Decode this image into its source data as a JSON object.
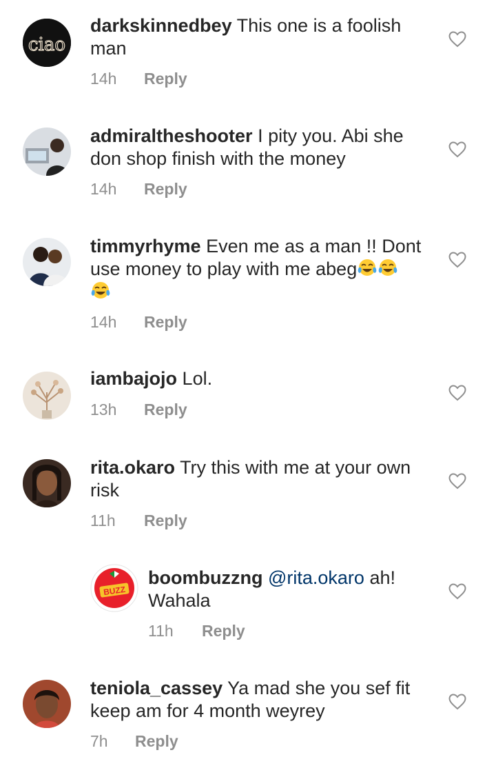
{
  "colors": {
    "username": "#262626",
    "meta": "#8e8e8e",
    "mention": "#003569",
    "heart_stroke": "#8e8e8e"
  },
  "comments": [
    {
      "username": "darkskinnedbey",
      "text": "This one is a foolish man",
      "time": "14h",
      "reply_label": "Reply",
      "avatar_icon": "ciao-neon-avatar",
      "avatar_text": "ciao"
    },
    {
      "username": "admiraltheshooter",
      "text": "I pity you. Abi she don shop finish with the money",
      "time": "14h",
      "reply_label": "Reply",
      "avatar_icon": "photo-avatar"
    },
    {
      "username": "timmyrhyme",
      "text": "Even me as a man !! Dont use money to play with me abeg",
      "time": "14h",
      "reply_label": "Reply",
      "avatar_icon": "photo-avatar",
      "emojis": [
        "face-with-tears-of-joy",
        "face-with-tears-of-joy",
        "face-with-tears-of-joy"
      ]
    },
    {
      "username": "iambajojo",
      "text": "Lol.",
      "time": "13h",
      "reply_label": "Reply",
      "avatar_icon": "photo-avatar"
    },
    {
      "username": "rita.okaro",
      "text": "Try this with me at your own risk",
      "time": "11h",
      "reply_label": "Reply",
      "avatar_icon": "photo-avatar"
    },
    {
      "username": "boombuzzng",
      "mention": "@rita.okaro",
      "text": "ah! Wahala",
      "time": "11h",
      "reply_label": "Reply",
      "avatar_icon": "buzz-logo-avatar",
      "avatar_text": "BUZZ",
      "is_reply": true
    },
    {
      "username": "teniola_cassey",
      "text": "Ya mad she you sef fit keep am for 4 month weyrey",
      "time": "7h",
      "reply_label": "Reply",
      "avatar_icon": "photo-avatar"
    }
  ]
}
